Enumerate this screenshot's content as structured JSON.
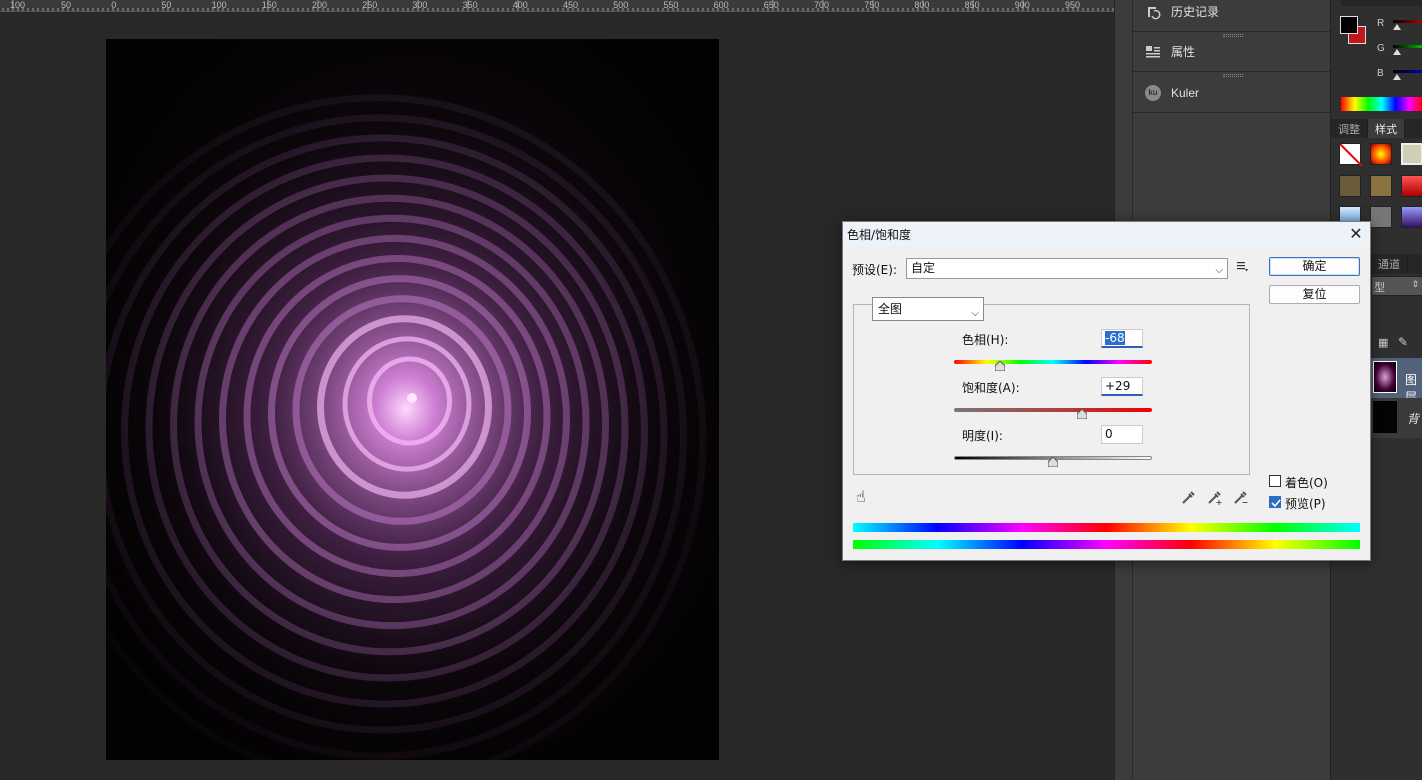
{
  "ruler": {
    "labels": [
      "100",
      "50",
      "0",
      "50",
      "100",
      "150",
      "200",
      "250",
      "300",
      "350",
      "400",
      "450",
      "500",
      "550",
      "600",
      "650",
      "700",
      "750",
      "800",
      "850",
      "900",
      "950"
    ]
  },
  "panels": {
    "history_label": "历史记录",
    "properties_label": "属性",
    "kuler_label": "Kuler",
    "kuler_icon_text": "ku"
  },
  "color_panel": {
    "r_label": "R",
    "g_label": "G",
    "b_label": "B",
    "foreground": "#000000",
    "background": "#c0161d"
  },
  "side_tabs": {
    "adjust": "调整",
    "styles": "样式"
  },
  "layers_panel": {
    "channels_tab": "通道",
    "kind_filter": "型",
    "layer1_name": "图层",
    "layer2_name": "背"
  },
  "dialog": {
    "title": "色相/饱和度",
    "preset_label": "预设(E):",
    "preset_value": "自定",
    "ok_button": "确定",
    "reset_button": "复位",
    "channel_value": "全图",
    "hue_label": "色相(H):",
    "hue_value": "-68",
    "hue_position": 0.23,
    "saturation_label": "饱和度(A):",
    "saturation_value": "+29",
    "saturation_position": 0.645,
    "lightness_label": "明度(I):",
    "lightness_value": "0",
    "lightness_position": 0.5,
    "colorize_label": "着色(O)",
    "colorize_checked": false,
    "preview_label": "预览(P)",
    "preview_checked": true
  }
}
